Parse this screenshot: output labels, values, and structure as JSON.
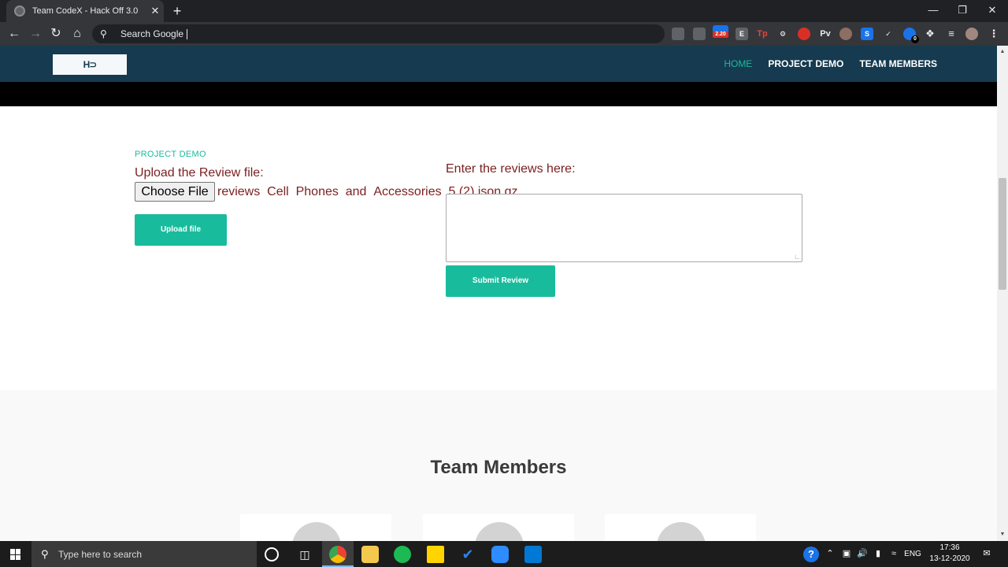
{
  "browser": {
    "tab_title": "Team CodeX - Hack Off 3.0",
    "tab_close": "✕",
    "new_tab": "+",
    "omnibox_text": "Search Google",
    "extension_badge": "2.20",
    "ext_labels": {
      "e": "E",
      "tp": "Tp",
      "pv": "Pv",
      "s": "S",
      "p_badge": "0"
    }
  },
  "site": {
    "logo_text": "H⊃",
    "nav": [
      {
        "label": "HOME"
      },
      {
        "label": "PROJECT DEMO"
      },
      {
        "label": "TEAM MEMBERS"
      }
    ],
    "accent": "#18bc9c",
    "navbar_color": "#163a4f"
  },
  "demo": {
    "section_label": "PROJECT DEMO",
    "upload_label": "Upload the Review file:",
    "choose_file": "Choose File",
    "file_name": "reviews_Cell_Phones_and_Accessories_5 (2).json.gz",
    "upload_button": "Upload file",
    "review_label": "Enter the reviews here:",
    "review_value": "",
    "submit_button": "Submit Review"
  },
  "team": {
    "title": "Team Members"
  },
  "taskbar": {
    "search_placeholder": "Type here to search",
    "lang": "ENG",
    "time": "17:36",
    "date": "13-12-2020"
  }
}
